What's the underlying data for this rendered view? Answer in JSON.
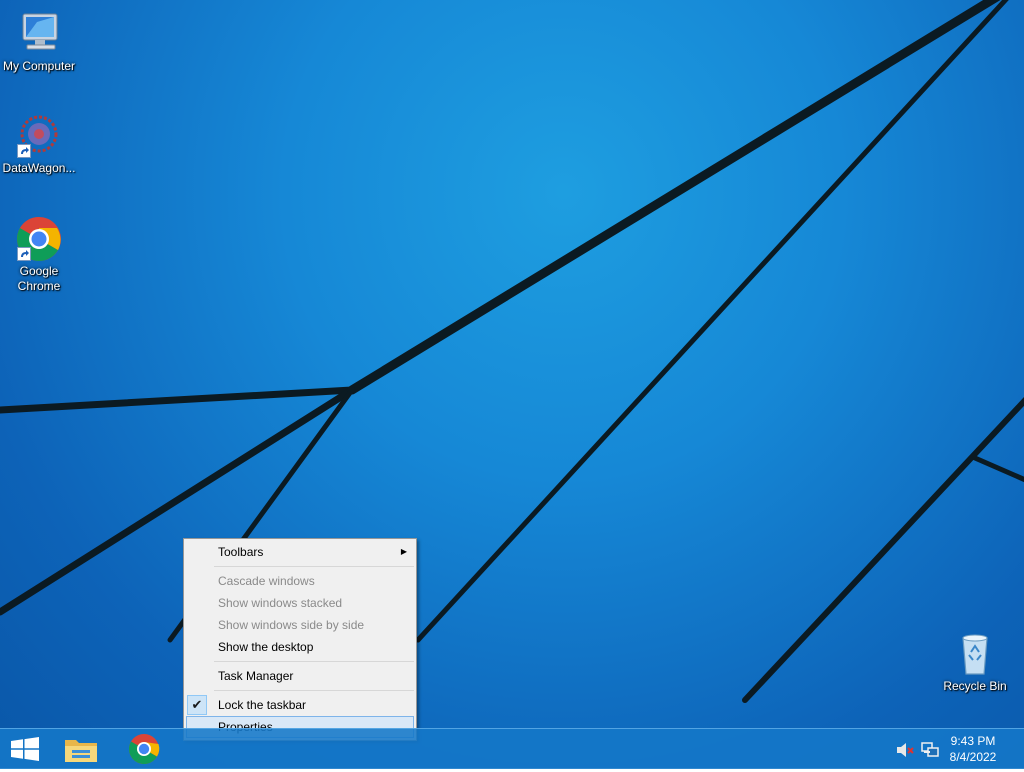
{
  "desktop": {
    "icons": [
      {
        "label": "My Computer"
      },
      {
        "label": "DataWagon..."
      },
      {
        "label_line1": "Google",
        "label_line2": "Chrome"
      },
      {
        "label": "Recycle Bin"
      }
    ]
  },
  "context_menu": {
    "items": {
      "toolbars": "Toolbars",
      "cascade": "Cascade windows",
      "stacked": "Show windows stacked",
      "side_by_side": "Show windows side by side",
      "show_desktop": "Show the desktop",
      "task_manager": "Task Manager",
      "lock_taskbar": "Lock the taskbar",
      "properties": "Properties"
    },
    "lock_taskbar_checked": true
  },
  "taskbar": {
    "clock": {
      "time": "9:43 PM",
      "date": "8/4/2022"
    },
    "icons": [
      "windows-start-icon",
      "file-explorer-icon",
      "chrome-icon",
      "speaker-muted-icon",
      "network-icon"
    ]
  },
  "colors": {
    "wallpaper": "#1688d6",
    "taskbar": "#1478c8",
    "menu_highlight": "#d9e8f7"
  }
}
